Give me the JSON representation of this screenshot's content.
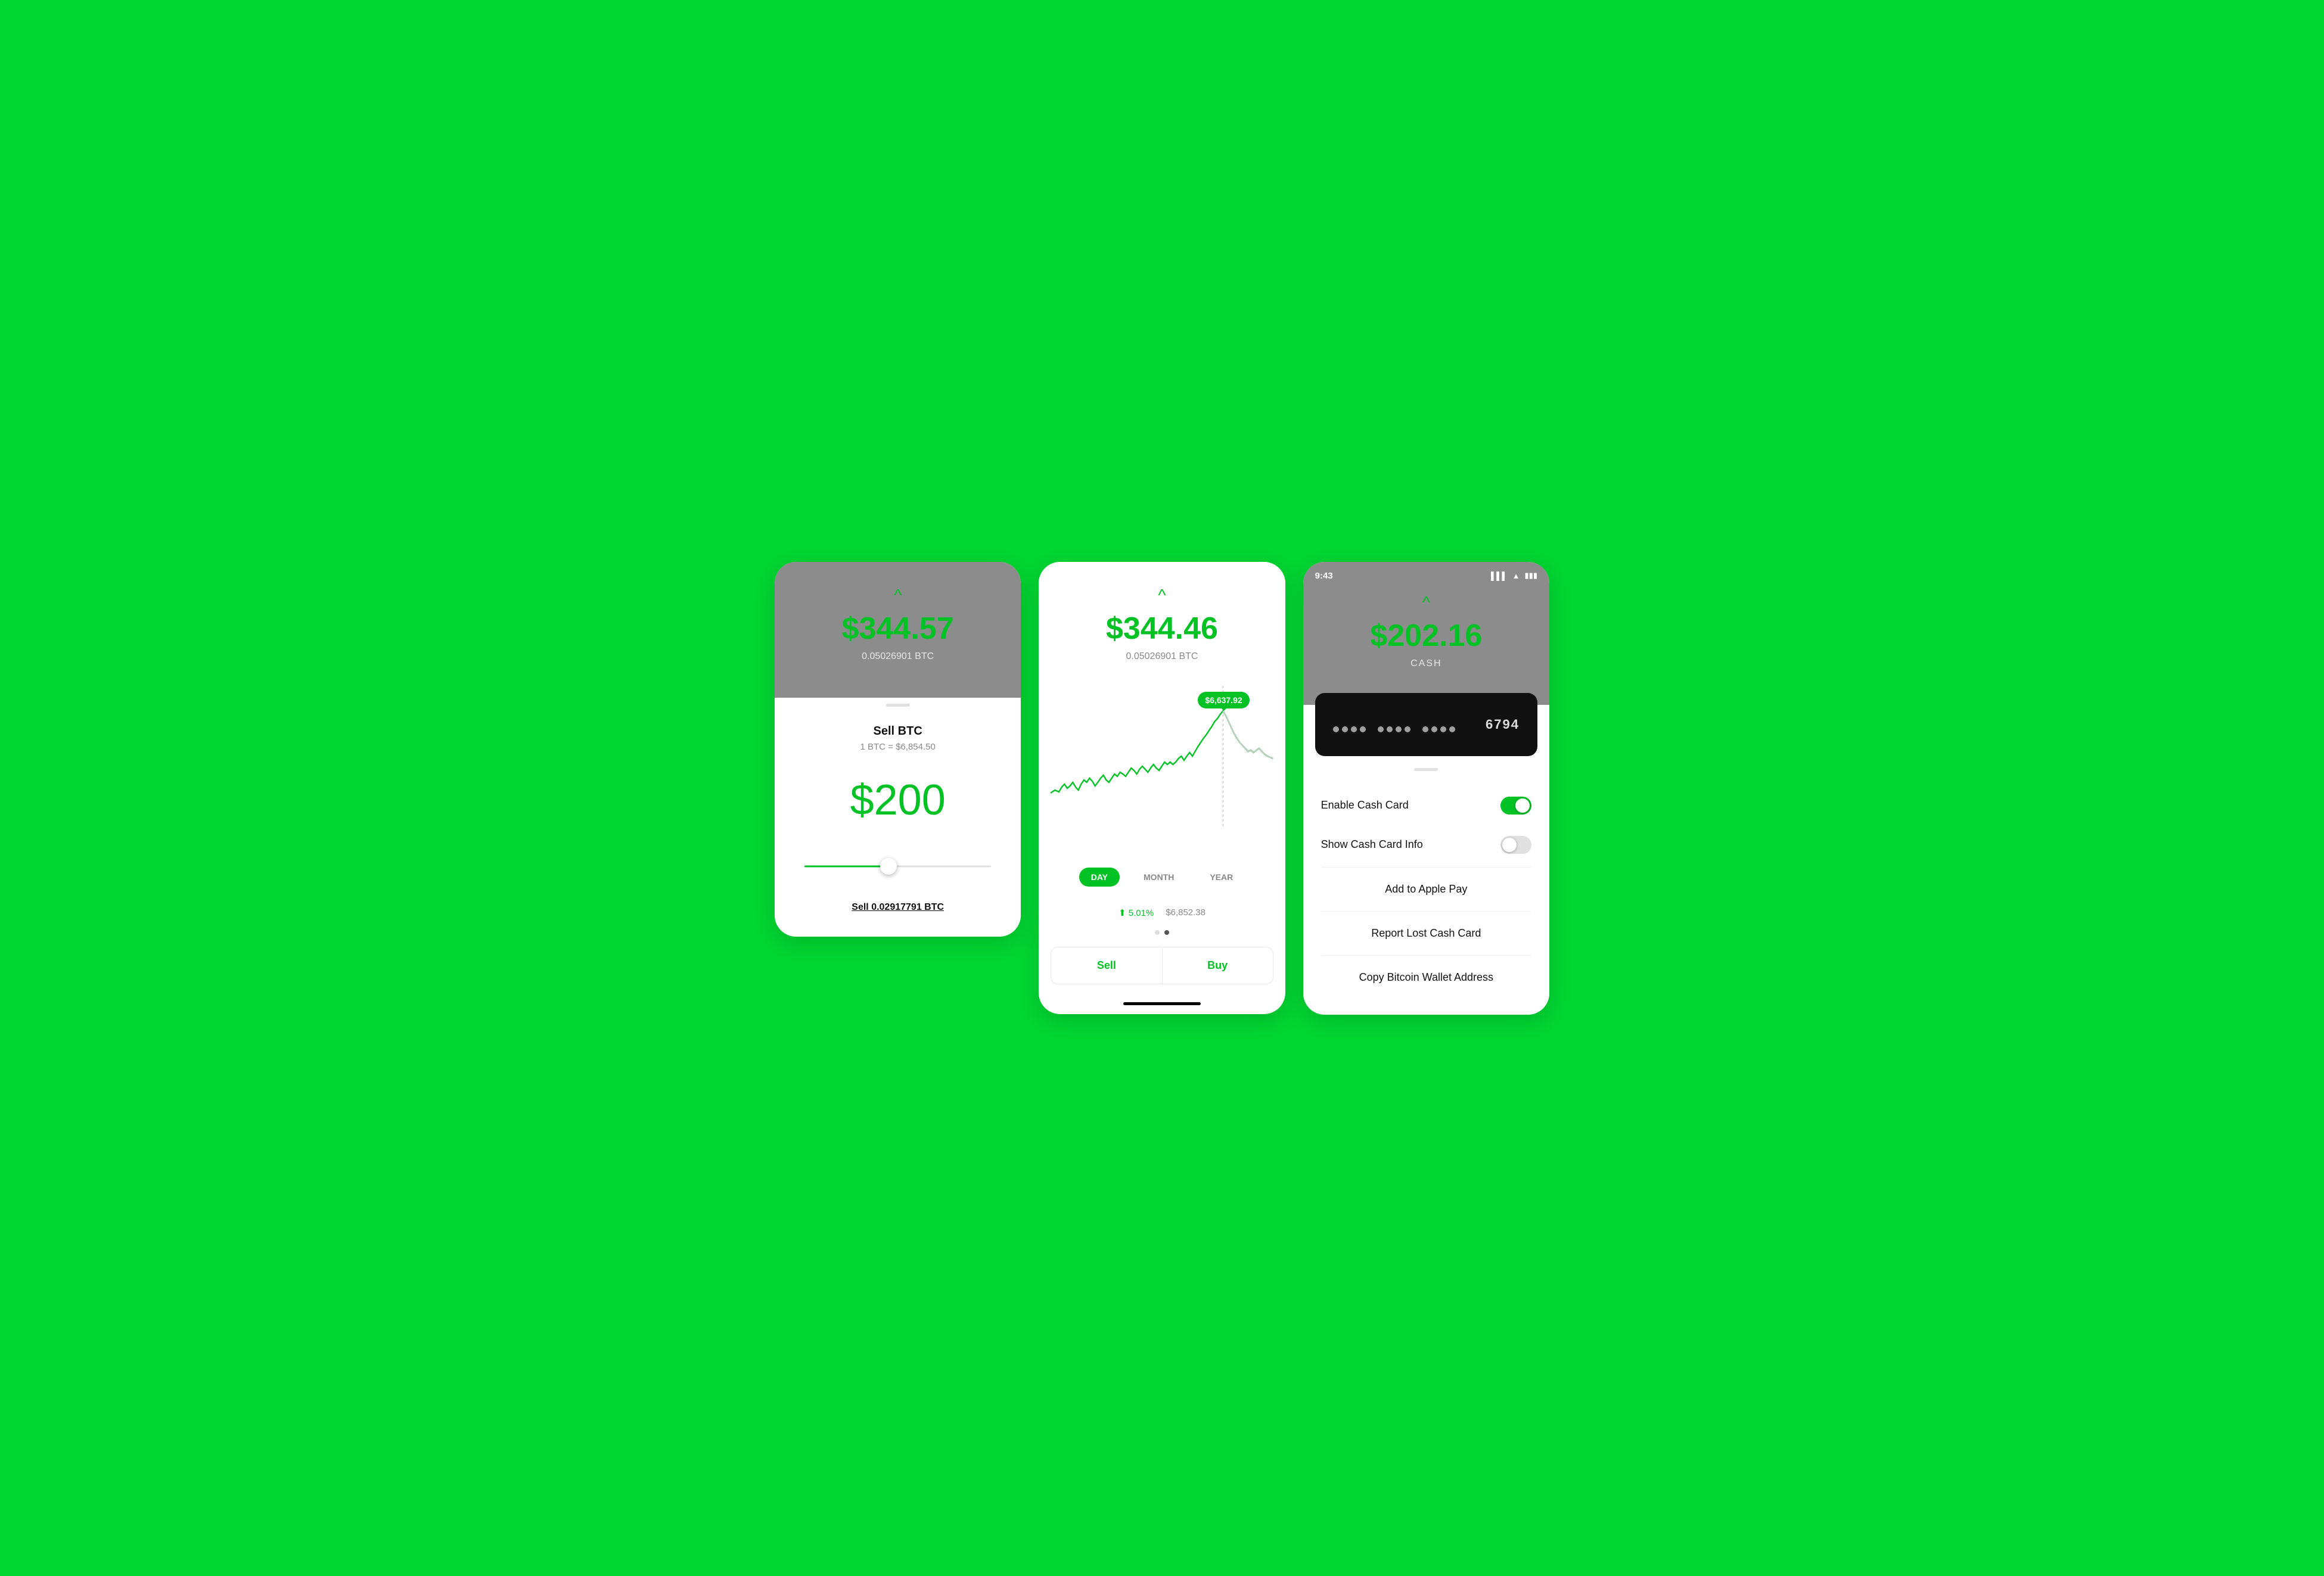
{
  "screen1": {
    "chevron": "^",
    "btc_value": "$344.57",
    "btc_amount": "0.05026901 BTC",
    "sell_title": "Sell BTC",
    "sell_rate": "1 BTC = $6,854.50",
    "sell_amount": "$200",
    "sell_btc_label": "Sell 0.02917791 BTC"
  },
  "screen2": {
    "chevron": "^",
    "btc_value": "$344.46",
    "btc_amount": "0.05026901 BTC",
    "tooltip_price": "$6,637.92",
    "time_tabs": [
      "DAY",
      "MONTH",
      "YEAR"
    ],
    "active_tab": "DAY",
    "stats_change": "⬆ 5.01%",
    "stats_price": "$6,852.38",
    "sell_label": "Sell",
    "buy_label": "Buy"
  },
  "screen3": {
    "status_time": "9:43",
    "chevron": "^",
    "cash_value": "$202.16",
    "cash_label": "CASH",
    "card_last4": "6794",
    "enable_label": "Enable Cash Card",
    "show_info_label": "Show Cash Card Info",
    "apple_pay_label": "Add to Apple Pay",
    "report_lost_label": "Report Lost Cash Card",
    "bitcoin_wallet_label": "Copy Bitcoin Wallet Address",
    "enable_on": true,
    "show_info_on": false
  }
}
